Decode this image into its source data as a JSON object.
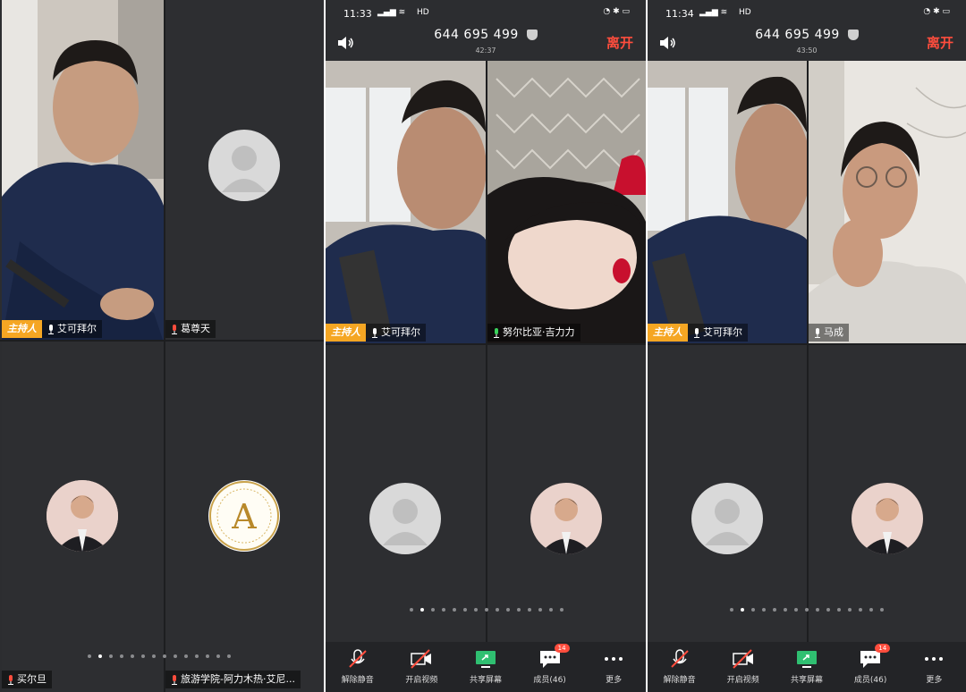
{
  "panel1": {
    "participants": [
      {
        "name": "艾可拜尔",
        "host": true
      },
      {
        "name": "葛尊天"
      },
      {
        "name": "买尔旦"
      },
      {
        "name": "旅游学院-阿力木热·艾尼..."
      }
    ]
  },
  "panel2": {
    "status_time": "11:33",
    "status_net": "HD",
    "meeting_id": "644 695 499",
    "timer": "42:37",
    "leave_label": "离开",
    "host_tag": "主持人",
    "participants": [
      {
        "name": "艾可拜尔"
      },
      {
        "name": "努尔比亚·吉力力"
      }
    ]
  },
  "panel3": {
    "status_time": "11:34",
    "status_net": "HD",
    "meeting_id": "644 695 499",
    "timer": "43:50",
    "leave_label": "离开",
    "host_tag": "主持人",
    "participants": [
      {
        "name": "艾可拜尔"
      },
      {
        "name": "马成"
      }
    ]
  },
  "toolbar": {
    "unmute": "解除静音",
    "video": "开启视频",
    "share": "共享屏幕",
    "members": "成员(46)",
    "more": "更多",
    "chat_badge": "14"
  },
  "colors": {
    "host_tag": "#f5a623",
    "leave": "#ff4d3d",
    "background": "#2c2d30"
  }
}
